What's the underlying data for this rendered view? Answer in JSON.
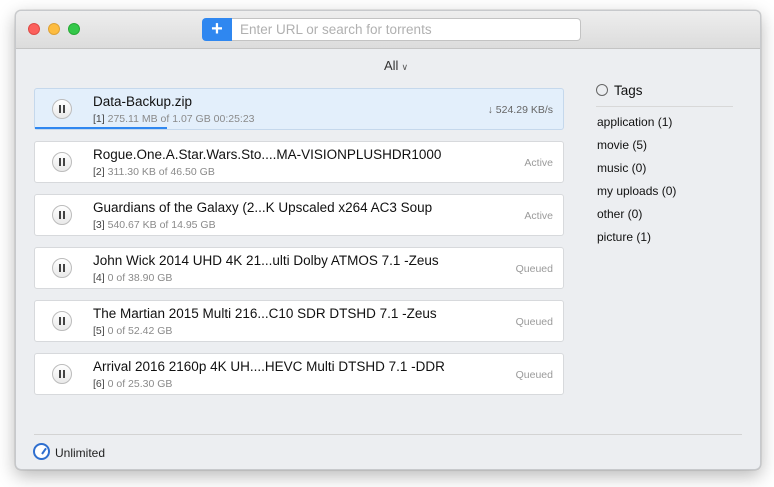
{
  "toolbar": {
    "add_label": "+",
    "search_placeholder": "Enter URL or search for torrents",
    "filter_label": "All",
    "filter_chevron": "∨"
  },
  "torrents": [
    {
      "name": "Data-Backup.zip",
      "index": "[1]",
      "info": "275.11 MB of 1.07 GB  00:25:23",
      "status": "↓ 524.29 KB/s",
      "progress": 0.25,
      "selected": true
    },
    {
      "name": "Rogue.One.A.Star.Wars.Sto....MA-VISIONPLUSHDR1000",
      "index": "[2]",
      "info": "311.30 KB of 46.50 GB",
      "status": "Active"
    },
    {
      "name": "Guardians of the Galaxy (2...K Upscaled x264 AC3 Soup",
      "index": "[3]",
      "info": "540.67 KB of 14.95 GB",
      "status": "Active"
    },
    {
      "name": "John Wick 2014 UHD 4K 21...ulti Dolby ATMOS 7.1 -Zeus",
      "index": "[4]",
      "info": "0 of 38.90 GB",
      "status": "Queued"
    },
    {
      "name": "The Martian 2015 Multi 216...C10 SDR DTSHD 7.1 -Zeus",
      "index": "[5]",
      "info": "0 of 52.42 GB",
      "status": "Queued"
    },
    {
      "name": "Arrival 2016 2160p 4K UH....HEVC Multi DTSHD 7.1 -DDR",
      "index": "[6]",
      "info": "0 of 25.30 GB",
      "status": "Queued"
    }
  ],
  "tags": {
    "title": "Tags",
    "items": [
      "application (1)",
      "movie (5)",
      "music (0)",
      "my uploads (0)",
      "other (0)",
      "picture (1)"
    ]
  },
  "footer": {
    "speed_limit": "Unlimited"
  },
  "colors": {
    "accent": "#2f87f0",
    "selected_row": "#e3effb"
  }
}
